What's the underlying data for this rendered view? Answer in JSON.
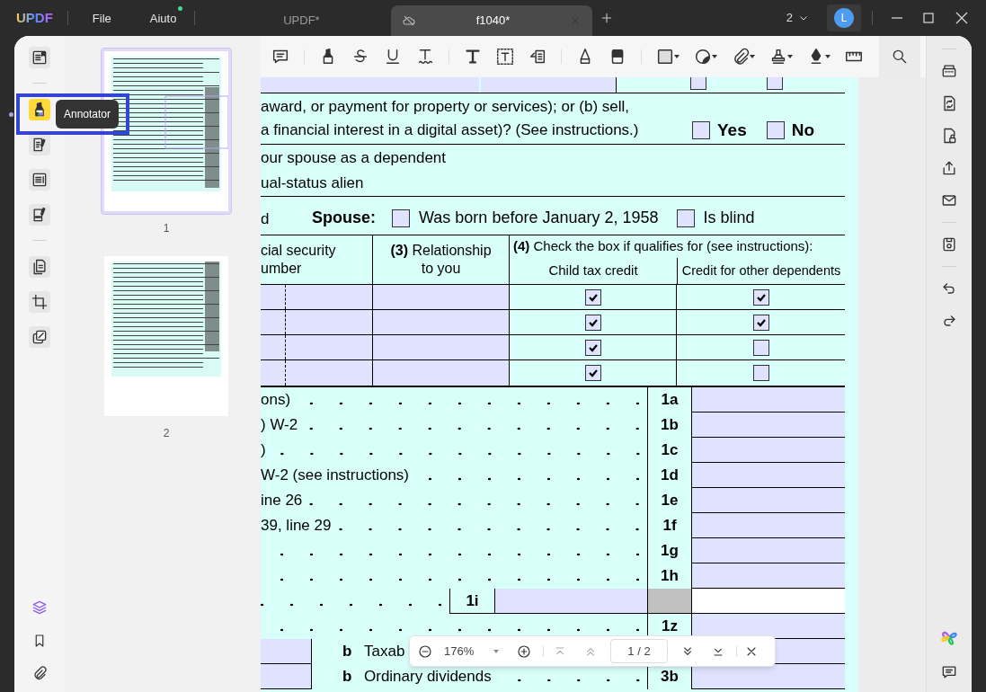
{
  "app": {
    "logo": "UPDF",
    "menus": [
      {
        "label": "File",
        "badge": false
      },
      {
        "label": "Aiuto",
        "badge": true
      }
    ]
  },
  "tabs": [
    {
      "label": "UPDF*",
      "selected": false
    },
    {
      "label": "f1040*",
      "selected": true
    }
  ],
  "window_controls": {
    "page_count": "2",
    "avatar": "L"
  },
  "tool_rail": {
    "tooltip": "Annotator",
    "items": [
      {
        "kind": "reader",
        "selected": false
      },
      {
        "kind": "annotator",
        "selected": true
      },
      {
        "kind": "edit",
        "selected": false
      },
      {
        "kind": "form",
        "selected": false
      },
      {
        "kind": "sign",
        "selected": false
      },
      {
        "kind": "organize",
        "selected": false
      },
      {
        "kind": "crop",
        "selected": false
      },
      {
        "kind": "compare",
        "selected": false
      }
    ]
  },
  "thumbnails": [
    {
      "label": "1",
      "selected": true
    },
    {
      "label": "2",
      "selected": false
    }
  ],
  "form": {
    "top_checkboxes": [
      {
        "checked": false
      },
      {
        "checked": false
      }
    ],
    "digital_asset": {
      "lines": [
        "award, or payment for property or services); or (b) sell,",
        "a financial interest in a digital asset)? (See instructions.)"
      ],
      "options": [
        {
          "label": "Yes",
          "checked": false
        },
        {
          "label": "No",
          "checked": false
        }
      ]
    },
    "status_lines": [
      "our spouse as a dependent",
      "ual-status alien"
    ],
    "spouse": {
      "lead": "d",
      "label": "Spouse:",
      "options": [
        {
          "label": "Was born before January 2, 1958",
          "checked": false
        },
        {
          "label": "Is blind",
          "checked": false
        }
      ]
    },
    "dependents": {
      "ssn_header": [
        "cial security",
        "umber"
      ],
      "relationship_header": "**(3)** Relationship to you",
      "qualify_header": "**(4)** Check the box if qualifies for (see instructions):",
      "credit_columns": [
        "Child tax credit",
        "Credit for other dependents"
      ],
      "rows": [
        {
          "child_tax_credit": true,
          "other_dependents": true
        },
        {
          "child_tax_credit": true,
          "other_dependents": true
        },
        {
          "child_tax_credit": true,
          "other_dependents": false
        },
        {
          "child_tax_credit": true,
          "other_dependents": false
        }
      ]
    },
    "income_lines": [
      {
        "kind": "line",
        "text": "ons)",
        "line": "1a"
      },
      {
        "kind": "line",
        "text": ") W-2",
        "line": "1b"
      },
      {
        "kind": "line",
        "text": ")",
        "line": "1c"
      },
      {
        "kind": "line",
        "text": "W-2 (see instructions)",
        "line": "1d"
      },
      {
        "kind": "line",
        "text": "ine 26",
        "line": "1e"
      },
      {
        "kind": "line",
        "text": "39, line 29",
        "line": "1f"
      },
      {
        "kind": "line",
        "line": "1g"
      },
      {
        "kind": "line",
        "line": "1h"
      },
      {
        "kind": "subtotal",
        "inner_line": "1i"
      },
      {
        "kind": "line",
        "line": "1z"
      },
      {
        "kind": "split",
        "letter": "b",
        "text": "Taxab"
      },
      {
        "kind": "split",
        "letter": "b",
        "text": "Ordinary dividends",
        "line": "3b"
      }
    ]
  },
  "zoom_bar": {
    "zoom": "176%",
    "page": "1 / 2"
  }
}
